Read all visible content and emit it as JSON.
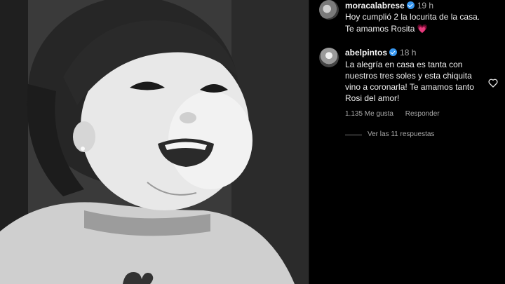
{
  "post": {
    "author": "moracalabrese",
    "time": "19 h",
    "caption_line1": "Hoy cumplió 2 la locurita de la casa.",
    "caption_line2": "Te amamos Rosita",
    "caption_emoji": "💗"
  },
  "comment": {
    "author": "abelpintos",
    "time": "18 h",
    "lines": [
      "La alegría en casa es tanta con",
      "nuestros tres soles y esta chiquita",
      "vino a coronarla! Te amamos tanto",
      "Rosi del amor!"
    ],
    "likes": "1.135 Me gusta",
    "reply_label": "Responder",
    "view_replies": "Ver las 11 respuestas"
  },
  "icons": {
    "verified": "verified-badge-icon",
    "like": "heart-outline-icon"
  },
  "colors": {
    "verified": "#3897f0",
    "emoji_heart": "#ff4f9a",
    "secondary_text": "#a8a8a8"
  }
}
